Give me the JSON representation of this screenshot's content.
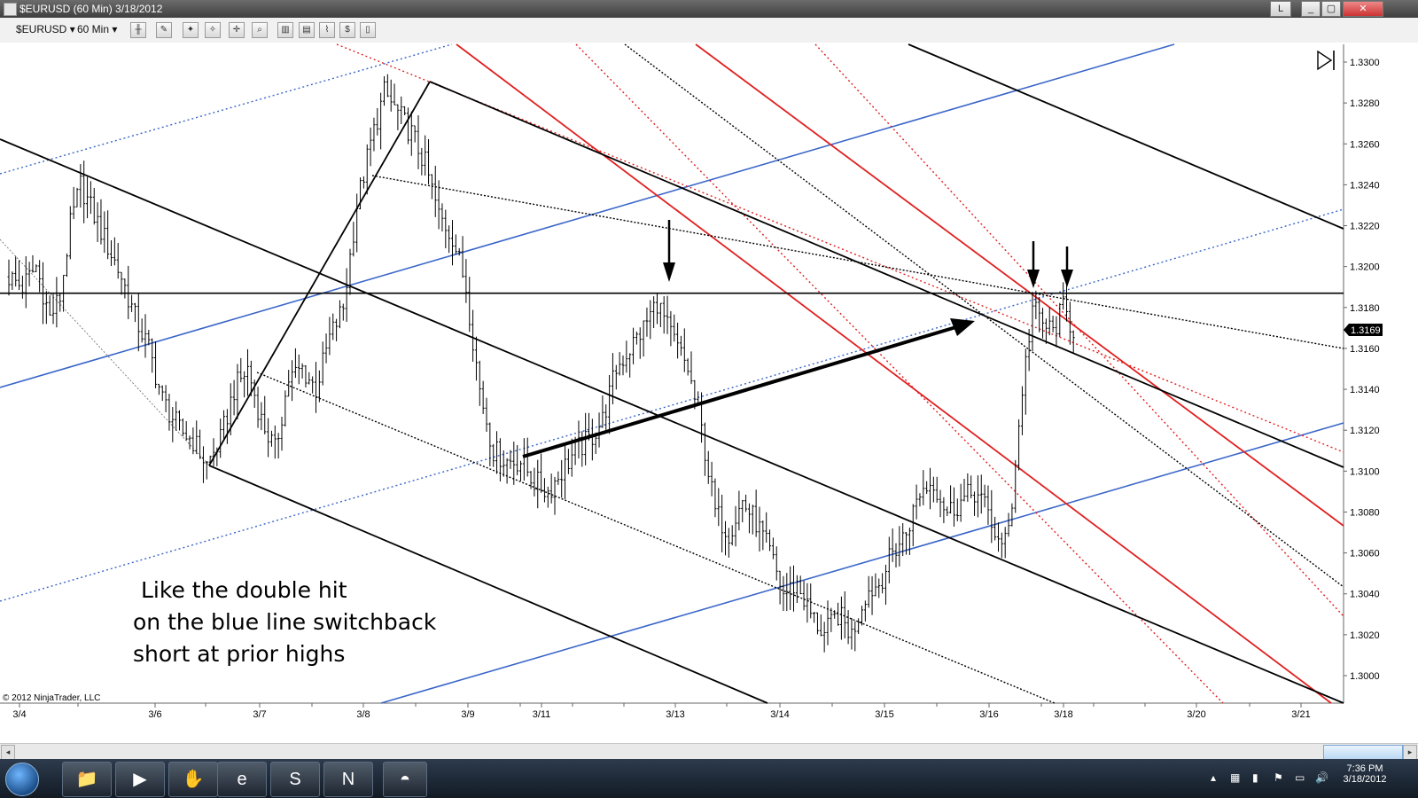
{
  "window": {
    "title": "$EURUSD (60 Min)  3/18/2012",
    "buttons": [
      "L",
      "_",
      "▢",
      "✕"
    ]
  },
  "toolbar": {
    "instrument": "$EURUSD",
    "interval": "60 Min",
    "dropdown_glyph": "▾"
  },
  "chart_data": {
    "type": "bar",
    "title": "",
    "xlabel": "",
    "ylabel": "",
    "ylim": [
      1.299,
      1.3305
    ],
    "y_ticks": [
      "1.3300",
      "1.3280",
      "1.3260",
      "1.3240",
      "1.3220",
      "1.3200",
      "1.3180",
      "1.3160",
      "1.3140",
      "1.3120",
      "1.3100",
      "1.3080",
      "1.3060",
      "1.3040",
      "1.3020",
      "1.3000"
    ],
    "x_ticks": [
      "3/4",
      "3/6",
      "3/7",
      "3/8",
      "3/9",
      "3/11",
      "3/13",
      "3/14",
      "3/15",
      "3/16",
      "3/18",
      "3/20",
      "3/21"
    ],
    "last_price": "1.3169",
    "horizontal_level": 1.3187,
    "copyright": "© 2012 NinjaTrader, LLC",
    "annotation_lines": [
      "Like the double hit",
      "on the blue line switchback",
      "short at prior highs"
    ],
    "colors": {
      "price_bars": "#000000",
      "blue_lines": "#3a66c9",
      "red_lines": "#e02020",
      "black_lines": "#000000",
      "last_price_label": "#000000"
    },
    "price_path": [
      [
        0,
        1.3195
      ],
      [
        4,
        1.319
      ],
      [
        8,
        1.32
      ],
      [
        12,
        1.3175
      ],
      [
        15,
        1.3185
      ],
      [
        18,
        1.322
      ],
      [
        21,
        1.324
      ],
      [
        25,
        1.3225
      ],
      [
        29,
        1.321
      ],
      [
        33,
        1.3195
      ],
      [
        37,
        1.3175
      ],
      [
        41,
        1.316
      ],
      [
        45,
        1.3135
      ],
      [
        50,
        1.312
      ],
      [
        54,
        1.3115
      ],
      [
        58,
        1.3103
      ],
      [
        62,
        1.3115
      ],
      [
        66,
        1.314
      ],
      [
        70,
        1.315
      ],
      [
        74,
        1.3125
      ],
      [
        78,
        1.311
      ],
      [
        82,
        1.3145
      ],
      [
        86,
        1.315
      ],
      [
        90,
        1.314
      ],
      [
        94,
        1.3165
      ],
      [
        98,
        1.318
      ],
      [
        102,
        1.323
      ],
      [
        106,
        1.326
      ],
      [
        110,
        1.3285
      ],
      [
        114,
        1.3275
      ],
      [
        118,
        1.3265
      ],
      [
        122,
        1.325
      ],
      [
        126,
        1.3225
      ],
      [
        130,
        1.3215
      ],
      [
        134,
        1.319
      ],
      [
        138,
        1.314
      ],
      [
        142,
        1.311
      ],
      [
        146,
        1.3105
      ],
      [
        150,
        1.3105
      ],
      [
        154,
        1.3095
      ],
      [
        158,
        1.309
      ],
      [
        162,
        1.31
      ],
      [
        166,
        1.311
      ],
      [
        170,
        1.3115
      ],
      [
        174,
        1.3125
      ],
      [
        178,
        1.315
      ],
      [
        182,
        1.316
      ],
      [
        186,
        1.317
      ],
      [
        190,
        1.3183
      ],
      [
        193,
        1.317
      ],
      [
        196,
        1.316
      ],
      [
        199,
        1.315
      ],
      [
        203,
        1.312
      ],
      [
        207,
        1.308
      ],
      [
        211,
        1.307
      ],
      [
        215,
        1.3085
      ],
      [
        219,
        1.3075
      ],
      [
        223,
        1.306
      ],
      [
        227,
        1.304
      ],
      [
        231,
        1.3045
      ],
      [
        235,
        1.303
      ],
      [
        239,
        1.302
      ],
      [
        243,
        1.303
      ],
      [
        247,
        1.302
      ],
      [
        251,
        1.304
      ],
      [
        255,
        1.3045
      ],
      [
        259,
        1.306
      ],
      [
        263,
        1.307
      ],
      [
        267,
        1.309
      ],
      [
        271,
        1.3095
      ],
      [
        275,
        1.308
      ],
      [
        279,
        1.3085
      ],
      [
        283,
        1.309
      ],
      [
        287,
        1.308
      ],
      [
        291,
        1.306
      ],
      [
        294,
        1.3085
      ],
      [
        297,
        1.314
      ],
      [
        300,
        1.318
      ],
      [
        303,
        1.3172
      ],
      [
        306,
        1.3168
      ],
      [
        309,
        1.318
      ],
      [
        312,
        1.3169
      ]
    ]
  },
  "scrollbar": {
    "left_arrow": "◂",
    "right_arrow": "▸"
  },
  "taskbar": {
    "apps": [
      "📁",
      "▶",
      "✋",
      "e",
      "S",
      "N",
      "◓"
    ],
    "tray_icons": [
      "▴",
      "▦",
      "▮",
      "⚑",
      "▭",
      "🔊"
    ],
    "time": "7:36 PM",
    "date": "3/18/2012"
  }
}
